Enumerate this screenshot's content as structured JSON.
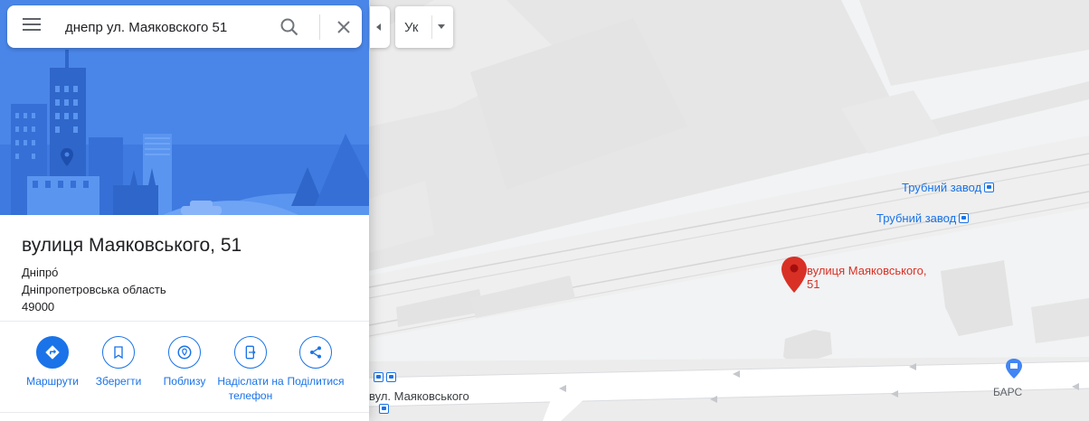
{
  "search": {
    "query": "днепр ул. Маяковского 51"
  },
  "language": {
    "label": "Ук"
  },
  "place": {
    "title": "вулиця Маяковського, 51",
    "lines": [
      "Дніпро́",
      "Дніпропетровська область",
      "49000"
    ]
  },
  "actions": [
    {
      "label": "Маршрути",
      "icon": "directions-icon"
    },
    {
      "label": "Зберегти",
      "icon": "bookmark-icon"
    },
    {
      "label": "Поблизу",
      "icon": "nearby-icon"
    },
    {
      "label": "Надіслати на телефон",
      "icon": "send-to-phone-icon"
    },
    {
      "label": "Поділитися",
      "icon": "share-icon"
    }
  ],
  "map": {
    "transit_labels": [
      "Трубний завод",
      "Трубний завод"
    ],
    "pin_label": "вулиця Маяковського, 51",
    "street_label": "вул. Маяковського",
    "poi_label": "БАРС"
  },
  "colors": {
    "accent": "#1a73e8",
    "pin": "#d93025",
    "hero": "#4285f4"
  }
}
